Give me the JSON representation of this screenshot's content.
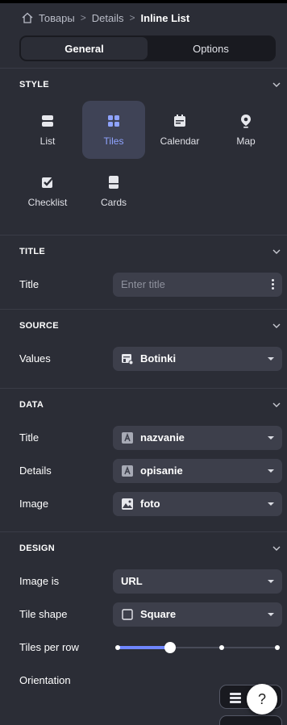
{
  "breadcrumb": {
    "items": [
      "Товары",
      "Details",
      "Inline List"
    ]
  },
  "tabs": {
    "general": "General",
    "options": "Options"
  },
  "style": {
    "heading": "STYLE",
    "items": [
      "List",
      "Tiles",
      "Calendar",
      "Map",
      "Checklist",
      "Cards"
    ],
    "selected": "Tiles"
  },
  "title_section": {
    "heading": "TITLE",
    "title_label": "Title",
    "title_placeholder": "Enter title"
  },
  "source": {
    "heading": "SOURCE",
    "values_label": "Values",
    "values_value": "Botinki"
  },
  "data_section": {
    "heading": "DATA",
    "title_label": "Title",
    "title_value": "nazvanie",
    "details_label": "Details",
    "details_value": "opisanie",
    "image_label": "Image",
    "image_value": "foto"
  },
  "design": {
    "heading": "DESIGN",
    "image_is_label": "Image is",
    "image_is_value": "URL",
    "tile_shape_label": "Tile shape",
    "tile_shape_value": "Square",
    "tiles_per_row_label": "Tiles per row",
    "tiles_per_row_level": 0.33,
    "orientation_label": "Orientation"
  },
  "help": {
    "label": "?"
  },
  "colors": {
    "accent": "#6f86ff",
    "panel": "#2b2d36"
  }
}
